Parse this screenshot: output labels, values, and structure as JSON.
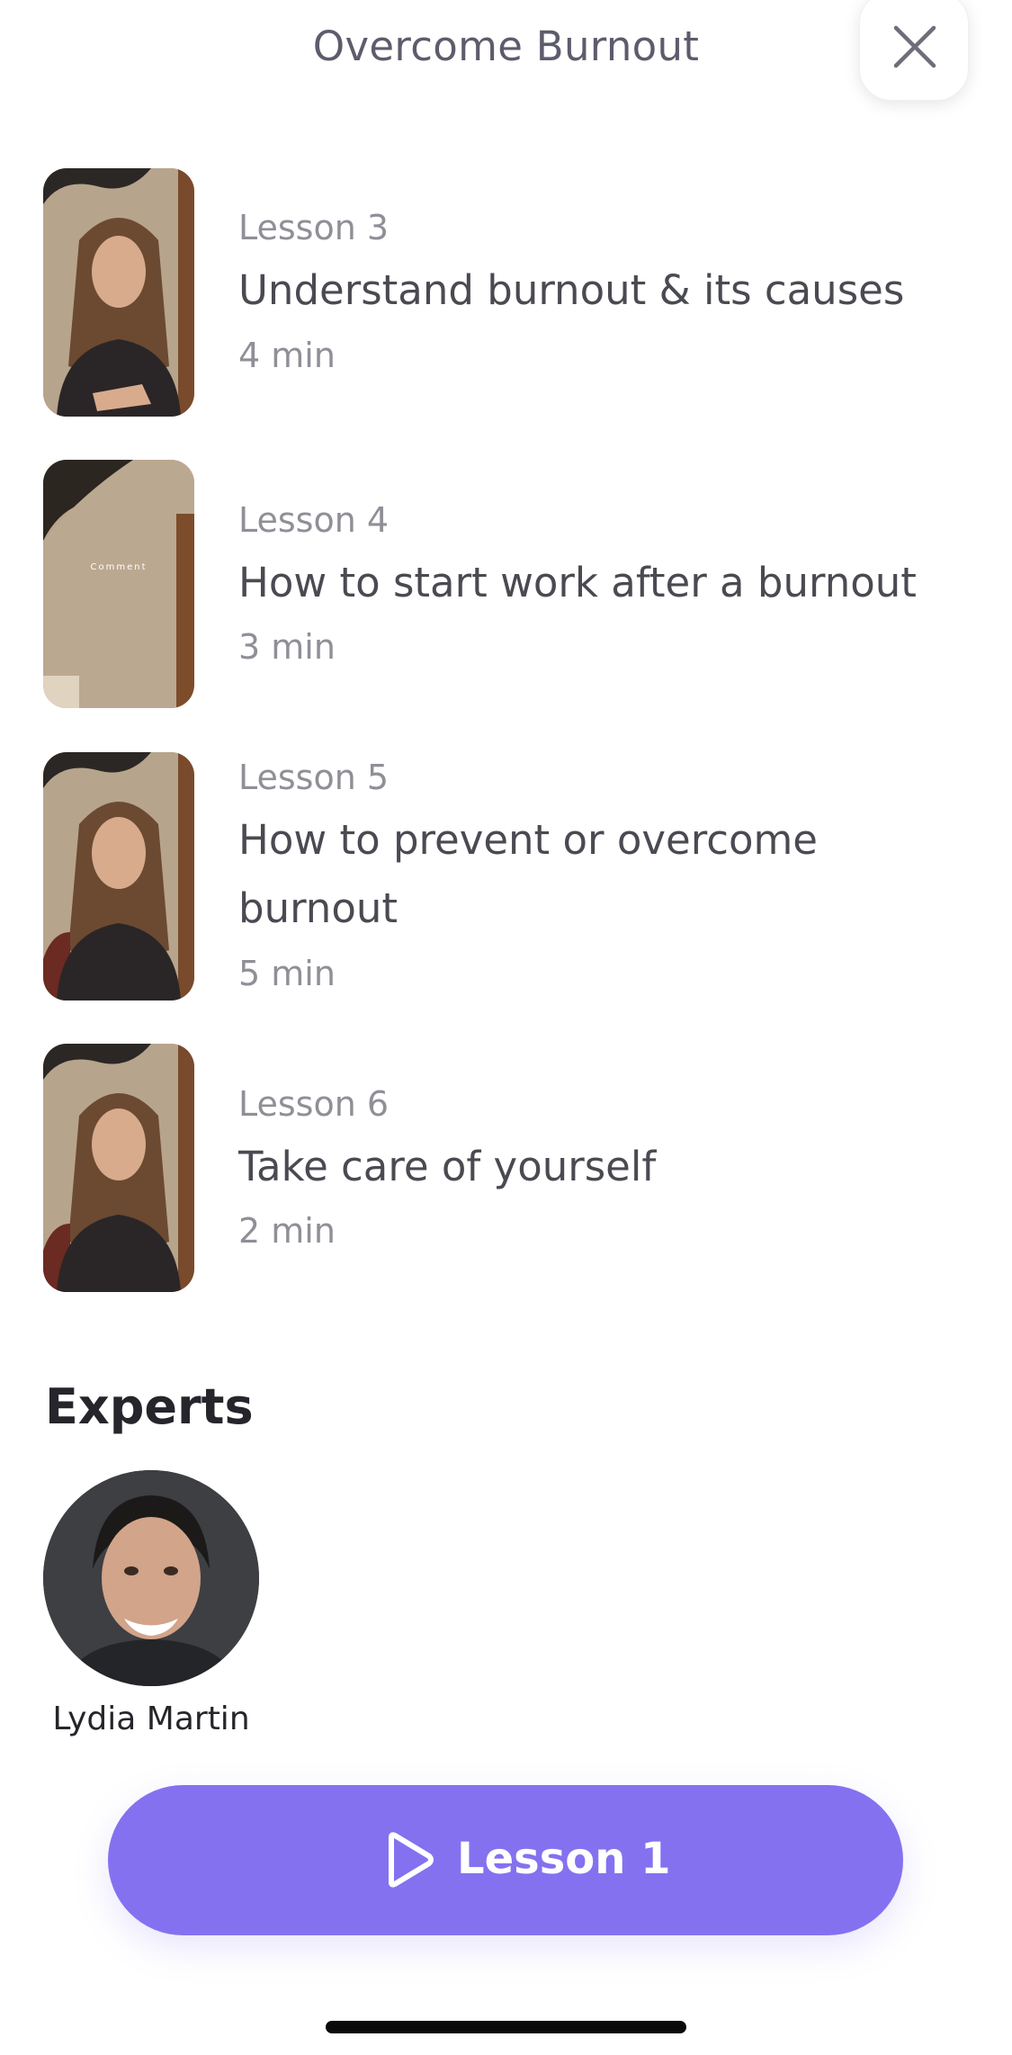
{
  "header": {
    "title": "Overcome Burnout",
    "close_icon": "close-icon"
  },
  "lessons": [
    {
      "number": "Lesson 3",
      "title": "Understand burnout & its causes",
      "duration": "4 min",
      "thumbnail": "video-thumbnail-presenter"
    },
    {
      "number": "Lesson 4",
      "title": "How to start work after a burnout",
      "duration": "3 min",
      "thumbnail": "video-thumbnail-text",
      "thumbnail_text": "Comment"
    },
    {
      "number": "Lesson 5",
      "title": "How to prevent or overcome burnout",
      "duration": "5 min",
      "thumbnail": "video-thumbnail-presenter"
    },
    {
      "number": "Lesson 6",
      "title": "Take care of yourself",
      "duration": "2 min",
      "thumbnail": "video-thumbnail-presenter"
    }
  ],
  "experts": {
    "heading": "Experts",
    "items": [
      {
        "name": "Lydia Martin"
      }
    ]
  },
  "cta": {
    "label": "Lesson 1",
    "icon": "play-icon"
  },
  "colors": {
    "accent": "#8471f0",
    "title_text": "#5d5c6c",
    "lesson_text": "#4a4a52",
    "muted_text": "#8f8f97"
  }
}
